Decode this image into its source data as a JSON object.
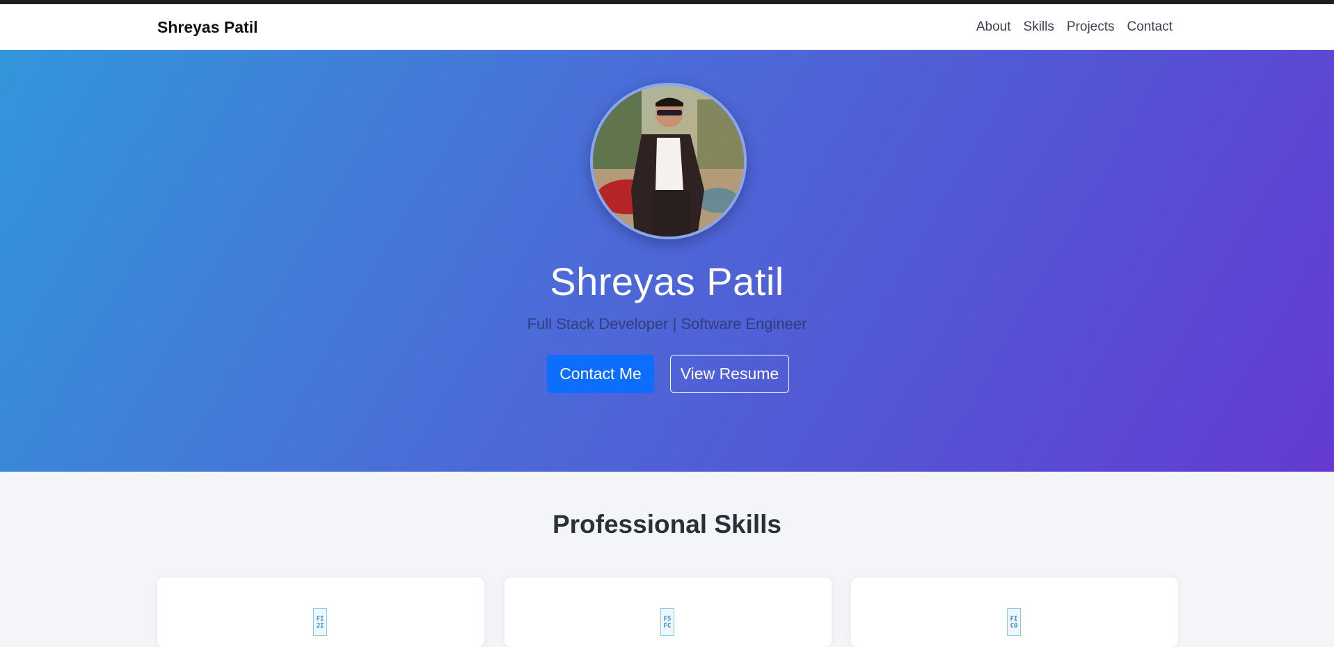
{
  "navbar": {
    "brand": "Shreyas Patil",
    "links": [
      "About",
      "Skills",
      "Projects",
      "Contact"
    ]
  },
  "hero": {
    "name": "Shreyas Patil",
    "subtitle": "Full Stack Developer | Software Engineer",
    "primary_button": "Contact Me",
    "secondary_button": "View Resume"
  },
  "skills": {
    "title": "Professional Skills",
    "cards": [
      {
        "icon_text_1": "FI",
        "icon_text_2": "2I"
      },
      {
        "icon_text_1": "F5",
        "icon_text_2": "FC"
      },
      {
        "icon_text_1": "FI",
        "icon_text_2": "C0"
      }
    ]
  },
  "colors": {
    "primary": "#0d6efd",
    "hero_gradient_start": "#3296dc",
    "hero_gradient_end": "#643ad2"
  }
}
